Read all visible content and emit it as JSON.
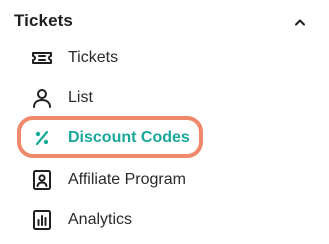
{
  "section": {
    "title": "Tickets",
    "chevron_icon": "chevron-up-icon",
    "expanded": true
  },
  "items": [
    {
      "label": "Tickets",
      "icon": "ticket-icon",
      "active": false
    },
    {
      "label": "List",
      "icon": "user-icon",
      "active": false
    },
    {
      "label": "Discount Codes",
      "icon": "percent-icon",
      "active": true
    },
    {
      "label": "Affiliate Program",
      "icon": "affiliate-icon",
      "active": false
    },
    {
      "label": "Analytics",
      "icon": "analytics-icon",
      "active": false
    }
  ],
  "colors": {
    "active_text": "#19a89a",
    "highlight_border": "#f0896b",
    "text": "#2a2a2a",
    "heading": "#1f1f1f"
  }
}
